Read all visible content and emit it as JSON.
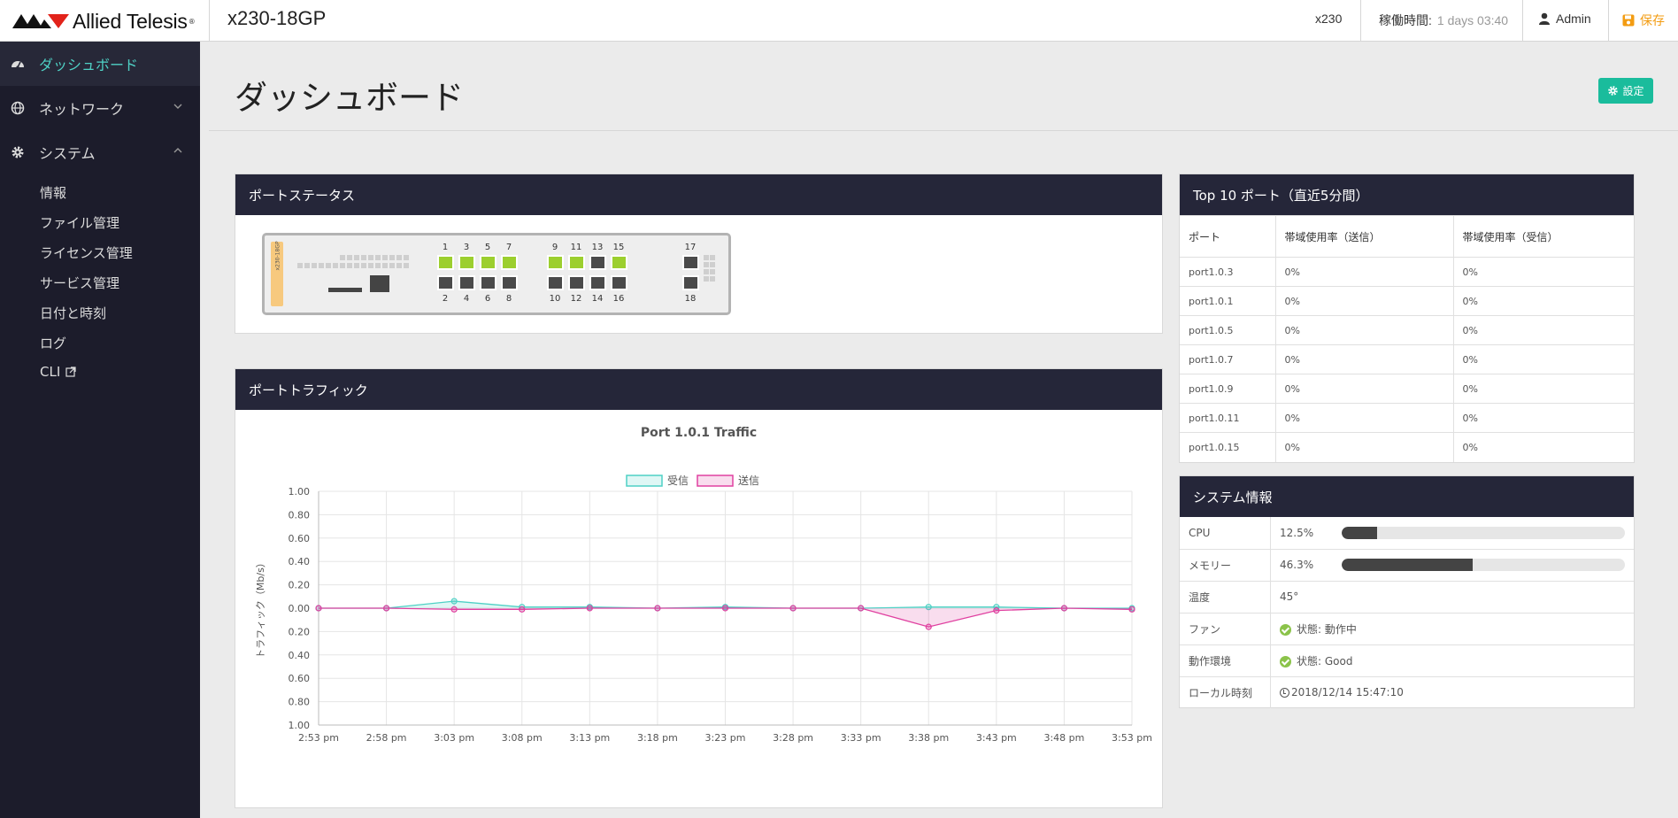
{
  "header": {
    "brand": "Allied Telesis",
    "device_title": "x230-18GP",
    "model": "x230",
    "uptime_label": "稼働時間:",
    "uptime_value": "1 days 03:40",
    "user": "Admin",
    "save_label": "保存",
    "colors": {
      "save": "#f39c12"
    }
  },
  "sidebar": {
    "items": [
      {
        "label": "ダッシュボード",
        "icon": "dashboard-icon",
        "active": true
      },
      {
        "label": "ネットワーク",
        "icon": "globe-icon",
        "expanded": false
      },
      {
        "label": "システム",
        "icon": "gear-icon",
        "expanded": true
      }
    ],
    "sub_items": [
      "情報",
      "ファイル管理",
      "ライセンス管理",
      "サービス管理",
      "日付と時刻",
      "ログ",
      "CLI"
    ],
    "colors": {
      "active": "#4fd1c5",
      "background": "#1c1c2b"
    }
  },
  "main": {
    "title": "ダッシュボード",
    "settings_label": "設定"
  },
  "port_status": {
    "title": "ポートステータス",
    "switch_label": "x230-18GP",
    "top_ports": [
      {
        "num": "1",
        "state": "up"
      },
      {
        "num": "3",
        "state": "up"
      },
      {
        "num": "5",
        "state": "up"
      },
      {
        "num": "7",
        "state": "up"
      },
      {
        "num": "9",
        "state": "up"
      },
      {
        "num": "11",
        "state": "up"
      },
      {
        "num": "13",
        "state": "down"
      },
      {
        "num": "15",
        "state": "up"
      },
      {
        "num": "17",
        "state": "down"
      }
    ],
    "bottom_ports": [
      {
        "num": "2",
        "state": "down"
      },
      {
        "num": "4",
        "state": "down"
      },
      {
        "num": "6",
        "state": "down"
      },
      {
        "num": "8",
        "state": "down"
      },
      {
        "num": "10",
        "state": "down"
      },
      {
        "num": "12",
        "state": "down"
      },
      {
        "num": "14",
        "state": "down"
      },
      {
        "num": "16",
        "state": "down"
      },
      {
        "num": "18",
        "state": "down"
      }
    ]
  },
  "port_traffic": {
    "title": "ポートトラフィック"
  },
  "chart_data": {
    "type": "line",
    "title": "Port 1.0.1 Traffic",
    "ylabel": "トラフィック（Mb/s）",
    "xlabel": "",
    "categories": [
      "2:53 pm",
      "2:58 pm",
      "3:03 pm",
      "3:08 pm",
      "3:13 pm",
      "3:18 pm",
      "3:23 pm",
      "3:28 pm",
      "3:33 pm",
      "3:38 pm",
      "3:43 pm",
      "3:48 pm",
      "3:53 pm"
    ],
    "y_tick_labels": [
      "1.00",
      "0.80",
      "0.60",
      "0.40",
      "0.20",
      "0.00",
      "0.20",
      "0.40",
      "0.60",
      "0.80",
      "1.00"
    ],
    "ylim": [
      -1,
      1
    ],
    "series": [
      {
        "name": "受信",
        "color": "#4fd1c5",
        "values": [
          0,
          0,
          0.06,
          0.01,
          0.01,
          0,
          0.01,
          0,
          0,
          0.01,
          0.01,
          0,
          0
        ]
      },
      {
        "name": "送信",
        "color": "#e040a0",
        "values": [
          0,
          0,
          -0.01,
          -0.01,
          0,
          0,
          0,
          0,
          0,
          -0.16,
          -0.02,
          0,
          -0.01
        ]
      }
    ],
    "grid": true,
    "legend": "top"
  },
  "top10": {
    "title": "Top 10 ポート（直近5分間）",
    "headers": [
      "ポート",
      "帯域使用率（送信）",
      "帯域使用率（受信）"
    ],
    "rows": [
      [
        "port1.0.3",
        "0%",
        "0%"
      ],
      [
        "port1.0.1",
        "0%",
        "0%"
      ],
      [
        "port1.0.5",
        "0%",
        "0%"
      ],
      [
        "port1.0.7",
        "0%",
        "0%"
      ],
      [
        "port1.0.9",
        "0%",
        "0%"
      ],
      [
        "port1.0.11",
        "0%",
        "0%"
      ],
      [
        "port1.0.15",
        "0%",
        "0%"
      ]
    ]
  },
  "system_info": {
    "title": "システム情報",
    "cpu_label": "CPU",
    "cpu_value": "12.5%",
    "cpu_fraction": 0.125,
    "mem_label": "メモリー",
    "mem_value": "46.3%",
    "mem_fraction": 0.463,
    "temp_label": "温度",
    "temp_value": "45°",
    "fan_label": "ファン",
    "fan_value": "状態: 動作中",
    "env_label": "動作環境",
    "env_value": "状態: Good",
    "time_label": "ローカル時刻",
    "time_value": "2018/12/14 15:47:10"
  }
}
